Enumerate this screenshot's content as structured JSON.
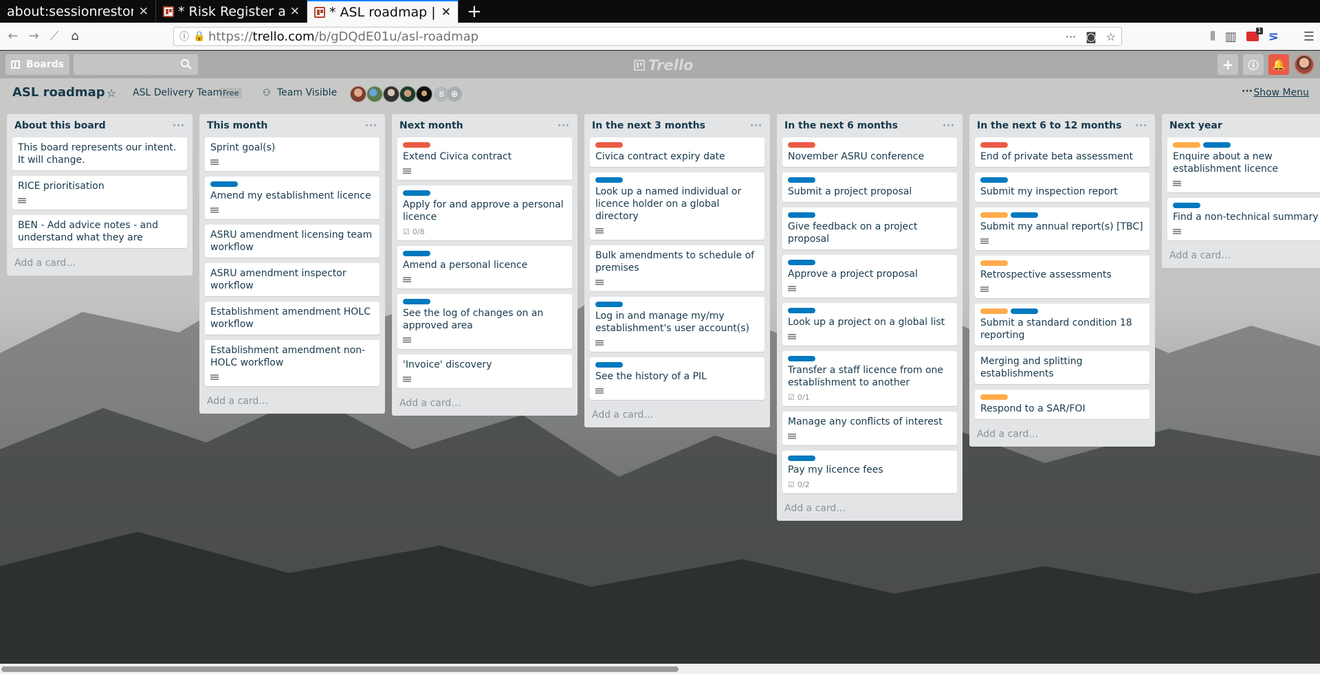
{
  "browser": {
    "tabs": [
      {
        "title": "about:sessionrestore"
      },
      {
        "title": "* Risk Register and"
      },
      {
        "title": "* ASL roadmap | Tr"
      }
    ],
    "url": {
      "proto": "https://",
      "host": "trello.com",
      "path": "/b/gDQdE01u/asl-roadmap"
    },
    "ext_badge": "1"
  },
  "header": {
    "boards_label": "Boards",
    "logo": "Trello",
    "search_placeholder": ""
  },
  "board": {
    "title": "ASL roadmap",
    "team": "ASL Delivery Team",
    "plan": "Free",
    "visibility": "Team Visible",
    "member_count": "8",
    "show_menu": "Show Menu"
  },
  "colors": {
    "red": "#eb5a46",
    "blue": "#0079bf",
    "orange": "#ffab4a"
  },
  "lists": [
    {
      "title": "About this board",
      "add_card": "Add a card…",
      "cards": [
        {
          "title": "This board represents our intent. It will change.",
          "labels": [],
          "desc": false
        },
        {
          "title": "RICE prioritisation",
          "labels": [],
          "desc": true
        },
        {
          "title": "BEN - Add advice notes - and understand what they are",
          "labels": [],
          "desc": false
        }
      ]
    },
    {
      "title": "This month",
      "add_card": "Add a card…",
      "cards": [
        {
          "title": "Sprint goal(s)",
          "labels": [],
          "desc": true
        },
        {
          "title": "Amend my establishment licence",
          "labels": [
            "blue"
          ],
          "desc": true
        },
        {
          "title": "ASRU amendment licensing team workflow",
          "labels": [],
          "desc": false
        },
        {
          "title": "ASRU amendment inspector workflow",
          "labels": [],
          "desc": false
        },
        {
          "title": "Establishment amendment HOLC workflow",
          "labels": [],
          "desc": false
        },
        {
          "title": "Establishment amendment non-HOLC workflow",
          "labels": [],
          "desc": true
        }
      ]
    },
    {
      "title": "Next month",
      "add_card": "Add a card…",
      "cards": [
        {
          "title": "Extend Civica contract",
          "labels": [
            "red"
          ],
          "desc": true
        },
        {
          "title": "Apply for and approve a personal licence",
          "labels": [
            "blue"
          ],
          "desc": false,
          "checklist": "0/8"
        },
        {
          "title": "Amend a personal licence",
          "labels": [
            "blue"
          ],
          "desc": true
        },
        {
          "title": "See the log of changes on an approved area",
          "labels": [
            "blue"
          ],
          "desc": true
        },
        {
          "title": "'Invoice' discovery",
          "labels": [],
          "desc": true
        }
      ]
    },
    {
      "title": "In the next 3 months",
      "add_card": "Add a card…",
      "cards": [
        {
          "title": "Civica contract expiry date",
          "labels": [
            "red"
          ],
          "desc": false
        },
        {
          "title": "Look up a named individual or licence holder on a global directory",
          "labels": [
            "blue"
          ],
          "desc": true
        },
        {
          "title": "Bulk amendments to schedule of premises",
          "labels": [],
          "desc": true
        },
        {
          "title": "Log in and manage my/my establishment's user account(s)",
          "labels": [
            "blue"
          ],
          "desc": true
        },
        {
          "title": "See the history of a PIL",
          "labels": [
            "blue"
          ],
          "desc": true
        }
      ]
    },
    {
      "title": "In the next 6 months",
      "add_card": "Add a card…",
      "cards": [
        {
          "title": "November ASRU conference",
          "labels": [
            "red"
          ],
          "desc": false
        },
        {
          "title": "Submit a project proposal",
          "labels": [
            "blue"
          ],
          "desc": false
        },
        {
          "title": "Give feedback on a project proposal",
          "labels": [
            "blue"
          ],
          "desc": false
        },
        {
          "title": "Approve a project proposal",
          "labels": [
            "blue"
          ],
          "desc": true
        },
        {
          "title": "Look up a project on a global list",
          "labels": [
            "blue"
          ],
          "desc": true
        },
        {
          "title": "Transfer a staff licence from one establishment to another",
          "labels": [
            "blue"
          ],
          "desc": false,
          "checklist": "0/1"
        },
        {
          "title": "Manage any conflicts of interest",
          "labels": [],
          "desc": true
        },
        {
          "title": "Pay my licence fees",
          "labels": [
            "blue"
          ],
          "desc": false,
          "checklist": "0/2"
        }
      ]
    },
    {
      "title": "In the next 6 to 12 months",
      "add_card": "Add a card…",
      "cards": [
        {
          "title": "End of private beta assessment",
          "labels": [
            "red"
          ],
          "desc": false
        },
        {
          "title": "Submit my inspection report",
          "labels": [
            "blue"
          ],
          "desc": false
        },
        {
          "title": "Submit my annual report(s) [TBC]",
          "labels": [
            "orange",
            "blue"
          ],
          "desc": true
        },
        {
          "title": "Retrospective assessments",
          "labels": [
            "orange"
          ],
          "desc": true
        },
        {
          "title": "Submit a standard condition 18 reporting",
          "labels": [
            "orange",
            "blue"
          ],
          "desc": false
        },
        {
          "title": "Merging and splitting establishments",
          "labels": [],
          "desc": false
        },
        {
          "title": "Respond to a SAR/FOI",
          "labels": [
            "orange"
          ],
          "desc": false
        }
      ]
    },
    {
      "title": "Next year",
      "add_card": "Add a card…",
      "cards": [
        {
          "title": "Enquire about a new establishment licence",
          "labels": [
            "orange",
            "blue"
          ],
          "desc": true
        },
        {
          "title": "Find a non-technical summary",
          "labels": [
            "blue"
          ],
          "desc": true
        }
      ]
    }
  ]
}
